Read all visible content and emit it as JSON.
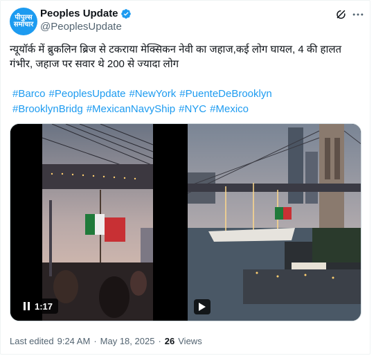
{
  "author": {
    "display_name": "Peoples Update",
    "handle": "@PeoplesUpdate",
    "avatar_text": "पीपुल्स समाचार",
    "verified": true
  },
  "tweet": {
    "text": "न्यूयॉर्क में ब्रुकलिन ब्रिज से टकराया मेक्सिकन नेवी का जहाज,कई लोग घायल, 4 की हालत गंभीर, जहाज पर सवार थे 200 से ज्यादा लोग",
    "hashtags": [
      "#Barco",
      "#PeoplesUpdate",
      "#NewYork",
      "#PuenteDeBrooklyn",
      "#BrooklynBridg",
      "#MexicanNavyShip",
      "#NYC",
      "#Mexico"
    ]
  },
  "media": {
    "video1": {
      "duration": "1:17",
      "icon": "pause-icon"
    },
    "video2": {
      "icon": "play-icon"
    }
  },
  "meta": {
    "edited_label": "Last edited",
    "time": "9:24 AM",
    "sep1": "·",
    "date": "May 18, 2025",
    "sep2": "·",
    "views_count": "26",
    "views_label": "Views"
  },
  "colors": {
    "accent": "#1d9bf0",
    "text": "#0f1419",
    "secondary": "#536471"
  }
}
